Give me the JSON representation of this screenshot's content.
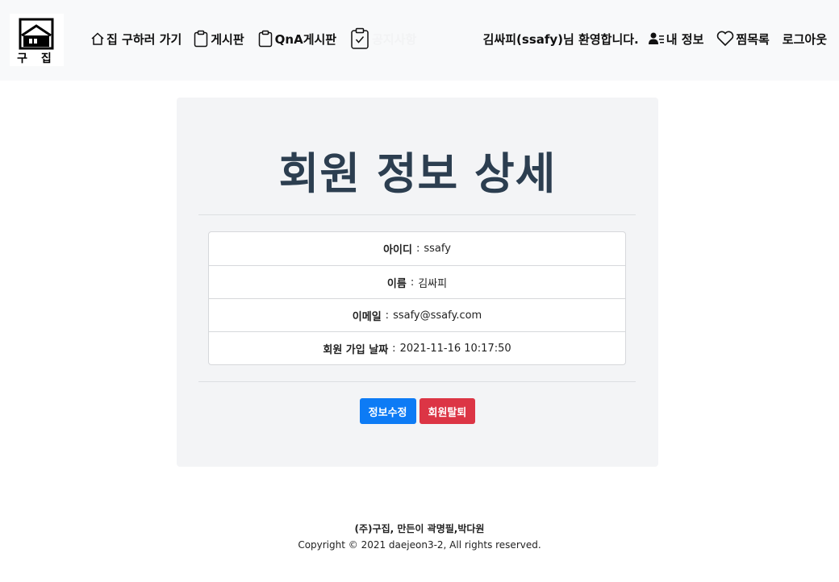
{
  "brand": {
    "logo_text": "구 집"
  },
  "nav": {
    "home": "집 구하러 가기",
    "board": "게시판",
    "qna": "QnA게시판",
    "notice": "공지사항",
    "welcome": "김싸피(ssafy)님 환영합니다.",
    "mypage": "내 정보",
    "wishlist": "찜목록",
    "logout": "로그아웃"
  },
  "page": {
    "title": "회원 정보 상세"
  },
  "info": [
    {
      "label": "아이디",
      "value": "ssafy"
    },
    {
      "label": "이름",
      "value": "김싸피"
    },
    {
      "label": "이메일",
      "value": "ssafy@ssafy.com"
    },
    {
      "label": "회원 가입 날짜",
      "value": "2021-11-16 10:17:50"
    }
  ],
  "actions": {
    "edit": "정보수정",
    "withdraw": "회원탈퇴"
  },
  "footer": {
    "line1": "(주)구집, 만든이 곽명필,박다원",
    "line2": "Copyright © 2021 daejeon3-2, All rights reserved."
  },
  "colors": {
    "primary": "#0d7bf5",
    "danger": "#dc3545",
    "title": "#2c3e50"
  }
}
